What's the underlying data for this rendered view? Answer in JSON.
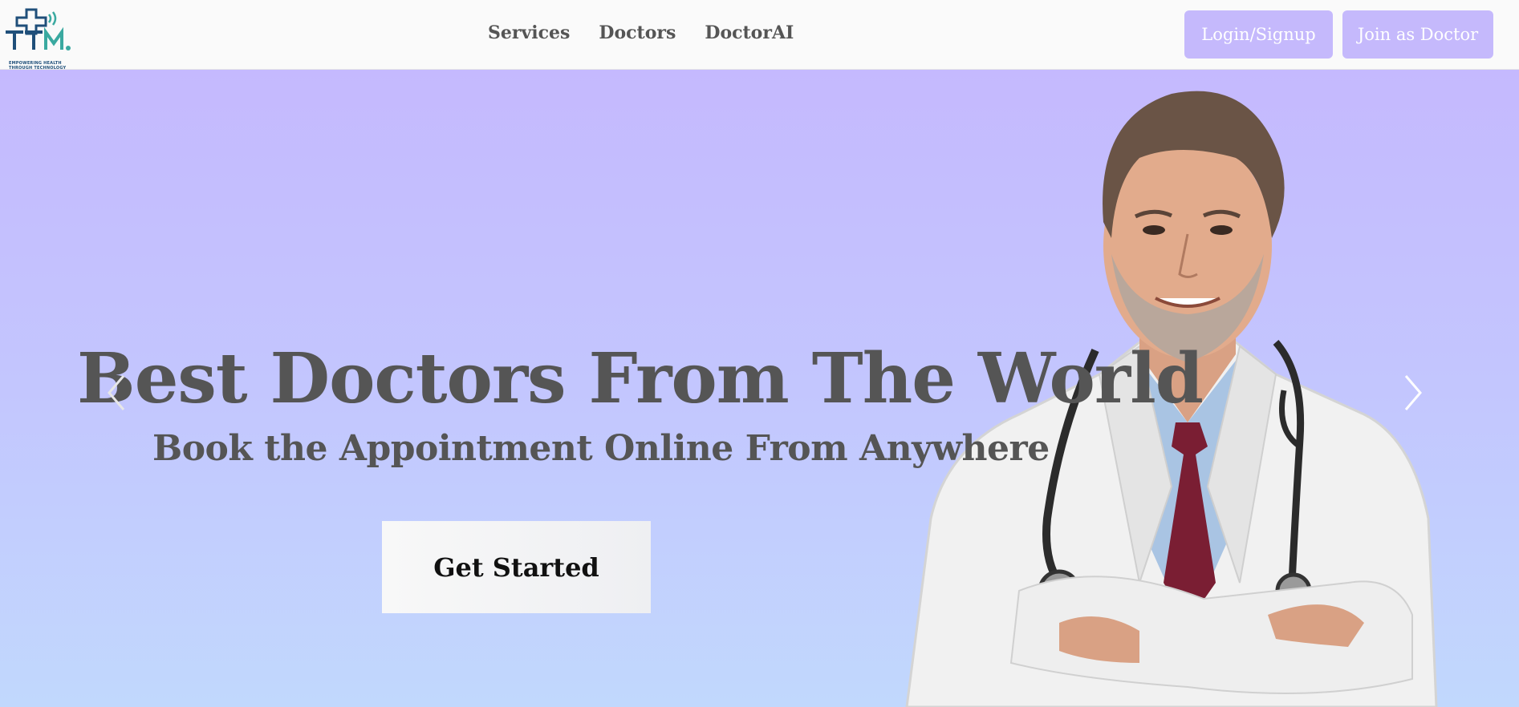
{
  "header": {
    "logo_text": "TTM",
    "logo_tagline_line1": "EMPOWERING HEALTH",
    "logo_tagline_line2": "THROUGH TECHNOLOGY",
    "nav": [
      {
        "label": "Services"
      },
      {
        "label": "Doctors"
      },
      {
        "label": "DoctorAI"
      }
    ],
    "login_label": "Login/Signup",
    "join_label": "Join as Doctor"
  },
  "hero": {
    "title": "Best Doctors From The World",
    "subtitle": "Book the Appointment Online From Anywhere",
    "cta_label": "Get Started"
  },
  "colors": {
    "accent": "#c5b9fc",
    "text": "#555555",
    "logo": "#1f4f7a",
    "logo_accent": "#3aa9a0"
  }
}
